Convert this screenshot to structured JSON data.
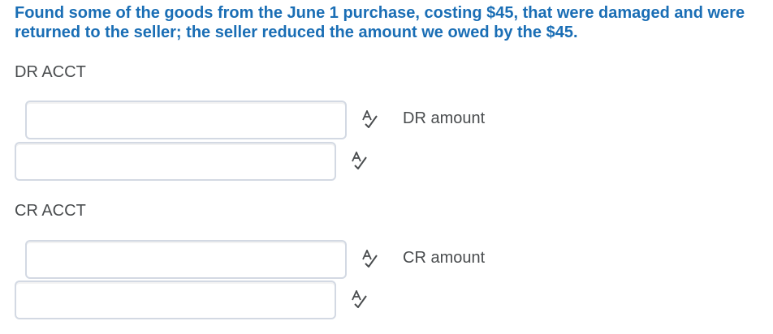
{
  "question_text": "Found some of the goods from the June 1 purchase, costing $45, that were damaged and were returned to the seller; the seller reduced the amount we owed by the $45.",
  "dr_section": {
    "label": "DR ACCT",
    "amount_label": "DR amount",
    "account_field_value": "",
    "amount_field_value": ""
  },
  "cr_section": {
    "label": "CR ACCT",
    "amount_label": "CR amount",
    "account_field_value": "",
    "amount_field_value": ""
  },
  "icons": {
    "spellcheck": "spellcheck-icon"
  },
  "colors": {
    "question": "#1a6eb5",
    "text": "#494c4e",
    "field_border": "#d3d9e3"
  }
}
